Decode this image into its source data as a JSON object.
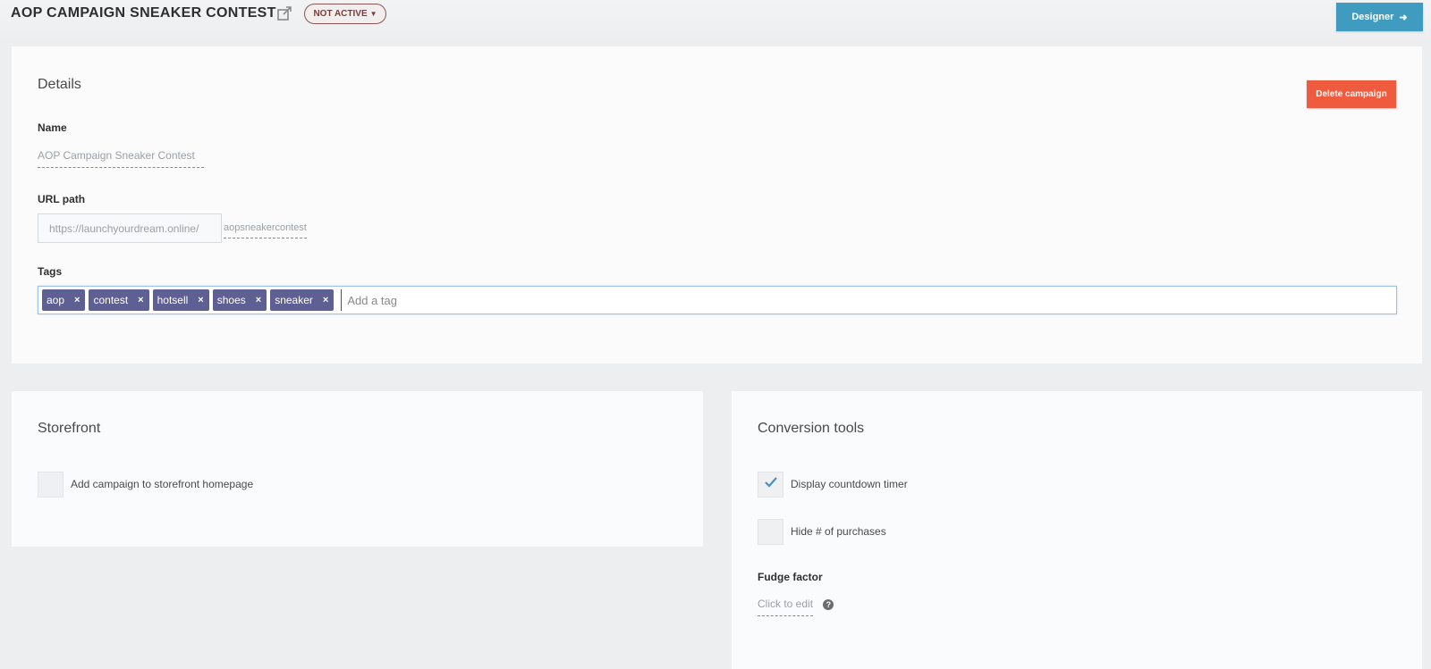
{
  "header": {
    "campaign_title": "AOP CAMPAIGN SNEAKER CONTEST",
    "status_label": "NOT ACTIVE",
    "designer_label": "Designer"
  },
  "details": {
    "section_title": "Details",
    "delete_label": "Delete campaign",
    "name_label": "Name",
    "name_value": "AOP Campaign Sneaker Contest",
    "url_label": "URL path",
    "url_prefix": "https://launchyourdream.online/",
    "url_slug": "aopsneakercontest",
    "tags_label": "Tags",
    "tags": [
      "aop",
      "contest",
      "hotsell",
      "shoes",
      "sneaker"
    ],
    "tag_placeholder": "Add a tag"
  },
  "storefront": {
    "section_title": "Storefront",
    "option_label": "Add campaign to storefront homepage",
    "option_checked": false
  },
  "conversion": {
    "section_title": "Conversion tools",
    "countdown_label": "Display countdown timer",
    "countdown_checked": true,
    "hide_purchases_label": "Hide # of purchases",
    "hide_purchases_checked": false,
    "fudge_label": "Fudge factor",
    "fudge_value": "Click to edit"
  },
  "colors": {
    "designer_button": "#3f9cc0",
    "delete_button": "#ee5b3f",
    "tag_chip": "#5e5f92",
    "status_pill": "#7b3b3b"
  },
  "icons": {
    "external_link": "external-link-icon",
    "designer_arrow": "arrow-right-icon",
    "tag_remove": "close-icon",
    "check": "checkmark-icon",
    "help": "question-circle-icon"
  }
}
